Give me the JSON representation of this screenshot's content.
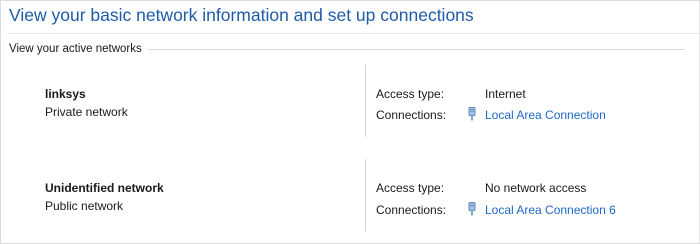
{
  "page": {
    "title": "View your basic network information and set up connections"
  },
  "active_networks": {
    "section_label": "View your active networks",
    "networks": [
      {
        "name": "linksys",
        "category": "Private network",
        "access_type_label": "Access type:",
        "access_type_value": "Internet",
        "connections_label": "Connections:",
        "connection_link": "Local Area Connection",
        "connection_icon": "ethernet-plug-icon"
      },
      {
        "name": "Unidentified network",
        "category": "Public network",
        "access_type_label": "Access type:",
        "access_type_value": "No network access",
        "connections_label": "Connections:",
        "connection_link": "Local Area Connection 6",
        "connection_icon": "ethernet-plug-icon"
      }
    ]
  },
  "colors": {
    "title": "#1e5ba8",
    "link": "#1f68c9",
    "icon": "#5b8ac0"
  }
}
